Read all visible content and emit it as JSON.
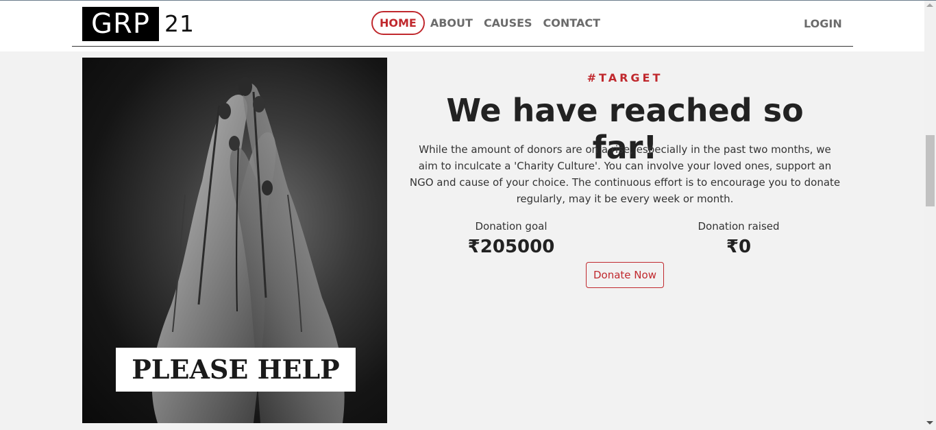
{
  "header": {
    "logo_left": "GRP",
    "logo_right": "21",
    "nav": [
      {
        "label": "HOME",
        "active": true
      },
      {
        "label": "ABOUT"
      },
      {
        "label": "CAUSES"
      },
      {
        "label": "CONTACT"
      }
    ],
    "login_label": "LOGIN"
  },
  "hero_image": {
    "caption": "PLEASE HELP"
  },
  "target": {
    "tag": "#TARGET",
    "headline": "We have reached so far!",
    "paragraph": "While the amount of donors are on a rise, especially in the past two months, we aim to inculcate a 'Charity Culture'. You can involve your loved ones, support an NGO and cause of your choice. The continuous effort is to encourage you to donate regularly, may it be every week or month.",
    "goal_label": "Donation goal",
    "goal_value": "₹205000",
    "raised_label": "Donation raised",
    "raised_value": "₹0",
    "donate_label": "Donate Now"
  },
  "colors": {
    "accent": "#c0282d",
    "background": "#f2f2f2"
  }
}
